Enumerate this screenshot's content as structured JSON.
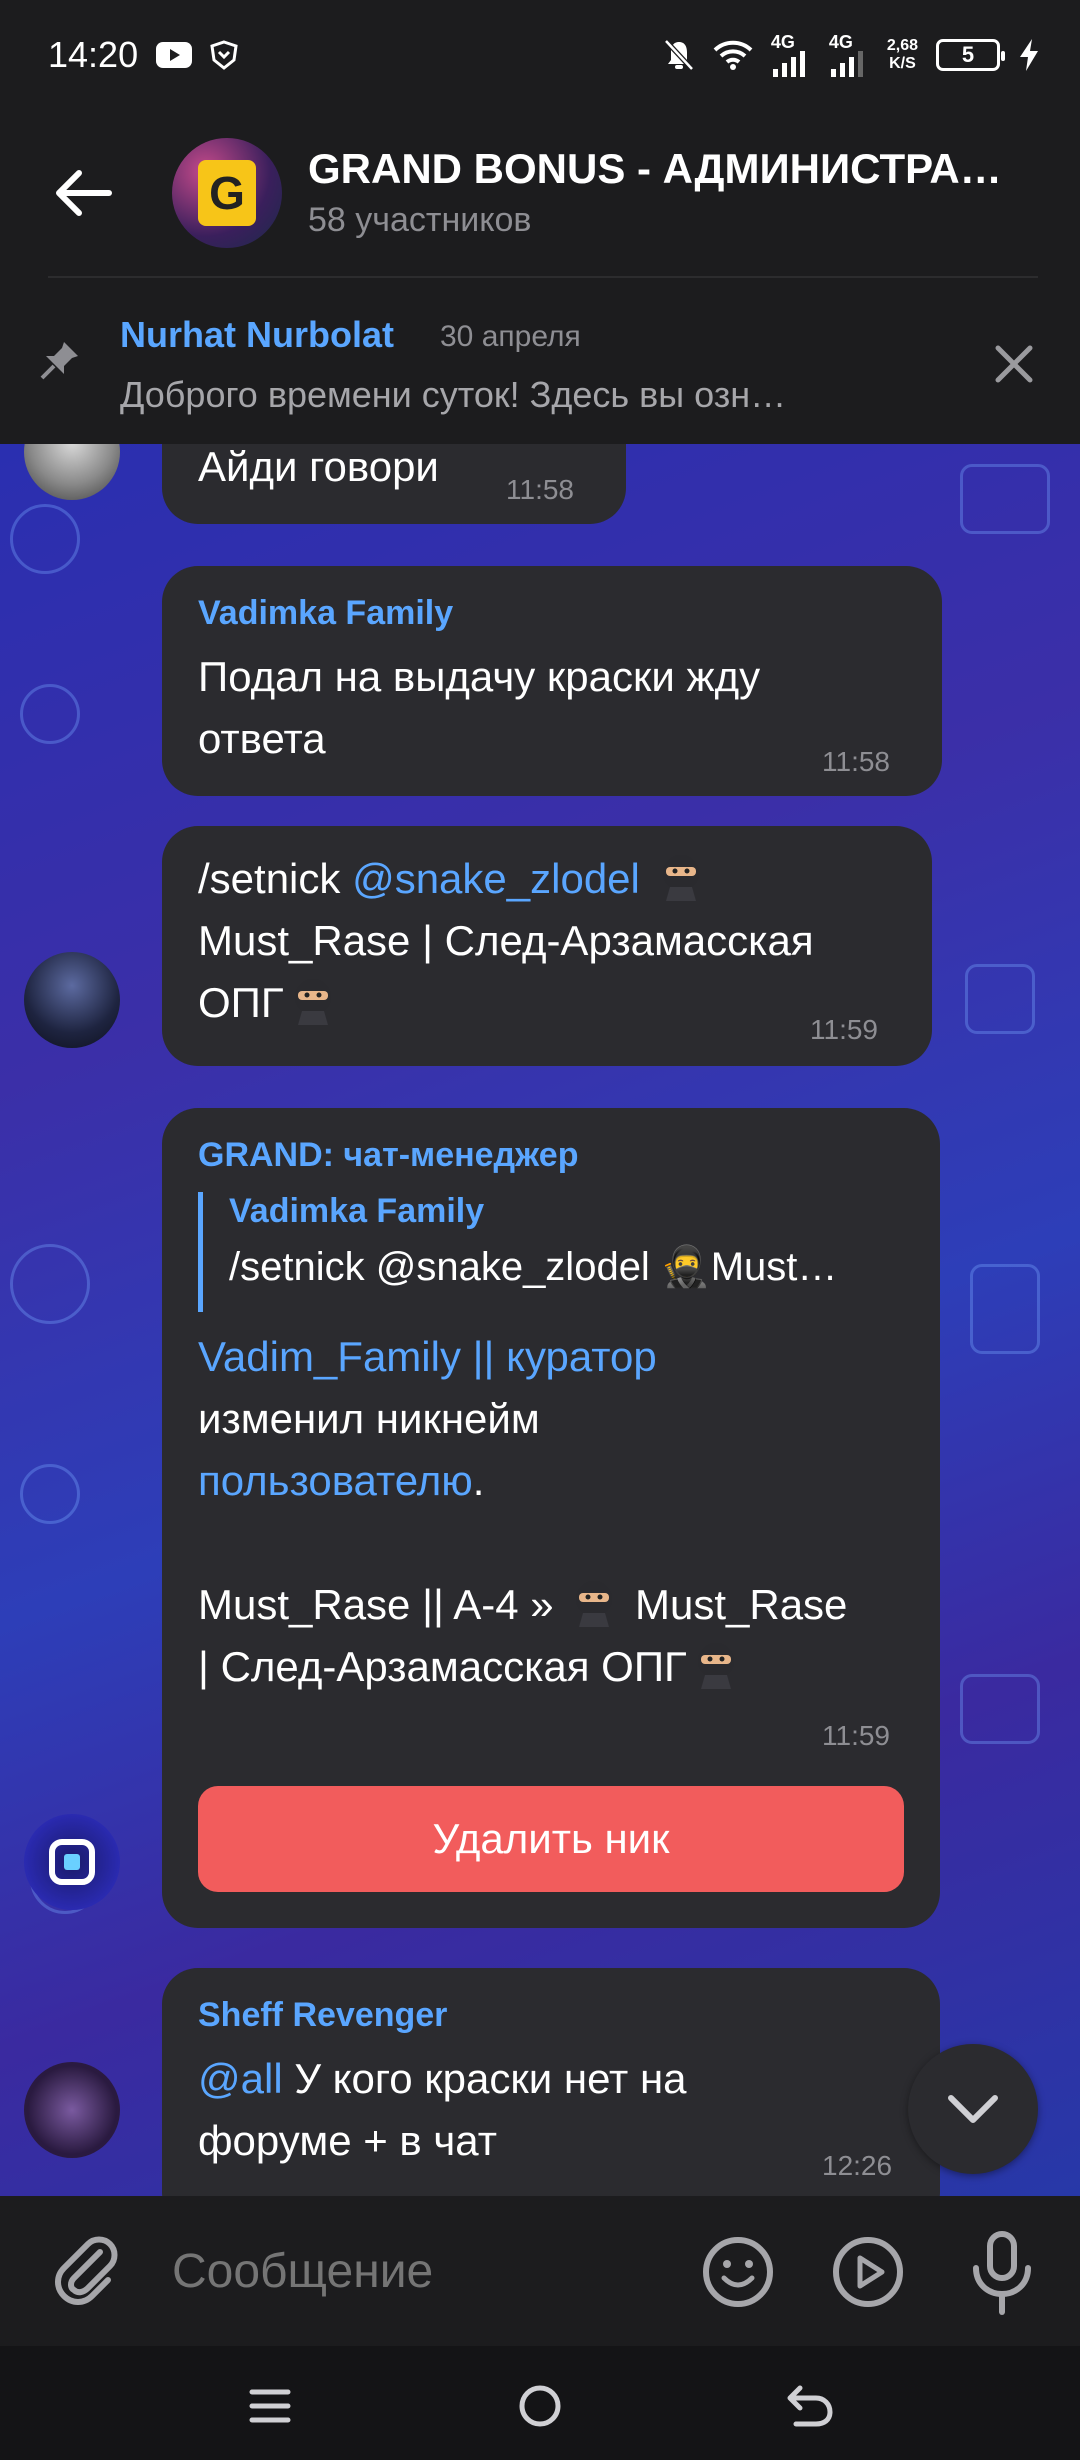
{
  "status_bar": {
    "time": "14:20",
    "net1": "4G",
    "net2": "4G",
    "speed_value": "2,68",
    "speed_unit": "K/S",
    "battery": "5"
  },
  "header": {
    "title": "GRAND BONUS - АДМИНИСТРА…",
    "subtitle": "58 участников",
    "avatar_letter": "G"
  },
  "pinned": {
    "author": "Nurhat Nurbolat",
    "date": "30 апреля",
    "text": "Доброго времени суток!  Здесь вы озн…"
  },
  "messages": [
    {
      "text": "Айди говори",
      "time": "11:58"
    },
    {
      "author": "Vadimka Family",
      "text": "Подал на выдачу краски жду ответа",
      "time": "11:58"
    },
    {
      "text_prefix": "/setnick ",
      "mention": "@snake_zlodel",
      "text_line2": "Must_Rase | След-Арзамасская",
      "text_line3": "ОПГ",
      "time": "11:59"
    },
    {
      "author": "GRAND: чат-менеджер",
      "reply_author": "Vadimka Family",
      "reply_text": "/setnick @snake_zlodel 🥷Must…",
      "link1": "Vadim_Family || куратор",
      "line2": "изменил никнейм",
      "link2": "пользователю",
      "dot": ".",
      "line4a": "Must_Rase || A-4 » ",
      "line4b": " Must_Rase",
      "line5": "| След-Арзамасская ОПГ",
      "time": "11:59",
      "button": "Удалить ник"
    },
    {
      "author": "Sheff Revenger",
      "mention": "@all",
      "text_line1": " У кого краски нет на",
      "text_line2": "форуме + в чат",
      "time": "12:26"
    }
  ],
  "composer": {
    "placeholder": "Сообщение"
  },
  "colors": {
    "accent": "#5aa6ff",
    "danger": "#f25c5c",
    "bubble": "#2b2b2f"
  }
}
